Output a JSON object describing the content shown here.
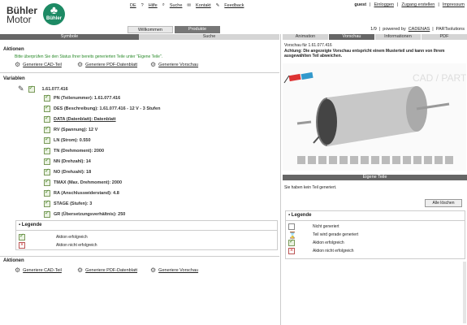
{
  "brand": {
    "name_line1": "Bühler",
    "name_line2": "Motor",
    "emblem_text": "Bühler"
  },
  "toplinks": {
    "lang": "DE",
    "help": "Hilfe",
    "search": "Suche",
    "contact": "Kontakt",
    "feedback": "Feedback"
  },
  "user": {
    "name": "guest",
    "login": "Einloggen",
    "request": "Zugang erstellen",
    "imprint": "Impressum"
  },
  "powered": {
    "page": "1/9",
    "text": "powered by",
    "cadenas": "CADENAS",
    "partsolutions": "PARTsolutions"
  },
  "main_tabs": [
    {
      "label": "Willkommen"
    },
    {
      "label": "Produkte"
    }
  ],
  "sub_tabs": {
    "symbols": "Symbole",
    "search": "Suche"
  },
  "right_tabs": [
    {
      "label": "Animation"
    },
    {
      "label": "Vorschau"
    },
    {
      "label": "Informationen"
    },
    {
      "label": "PDF"
    }
  ],
  "actions": {
    "title": "Aktionen",
    "note": "Bitte überprüfen Sie den Status Ihrer bereits generierten Teile unter \"Eigene Teile\".",
    "cad": "Generiere CAD-Teil",
    "pdf": "Generiere PDF-Datenblatt",
    "preview": "Generiere Vorschau"
  },
  "variables": {
    "title": "Variablen",
    "root": "1.61.077.416",
    "rows": [
      {
        "label": "PN (Teilenummer): 1.61.077.416"
      },
      {
        "label": "DES (Beschreibung): 1.61.077.416 - 12 V - 3 Stufen"
      },
      {
        "label": "DATA (Datenblatt): Datenblatt"
      },
      {
        "label": "RV (Spannung): 12 V"
      },
      {
        "label": "LN (Strom): 0.550"
      },
      {
        "label": "TN (Drehmoment): 2000"
      },
      {
        "label": "NN (Drehzahl): 14"
      },
      {
        "label": "NO (Drehzahl): 18"
      },
      {
        "label": "TMAX (Max. Drehmoment): 2000"
      },
      {
        "label": "RA (Anschlusswiderstand): 4.8"
      },
      {
        "label": "STAGE (Stufen): 3"
      },
      {
        "label": "GR (Übersetzungsverhältnis): 250"
      }
    ]
  },
  "legend_left": {
    "title": "Legende",
    "ok": "Aktion erfolgreich",
    "fail": "Aktion nicht erfolgreich"
  },
  "actions_bottom": {
    "title": "Aktionen",
    "cad": "Generiere CAD-Teil",
    "pdf": "Generiere PDF-Datenblatt",
    "preview": "Generiere Vorschau"
  },
  "preview": {
    "title": "Vorschau für 1.61.077.416",
    "warning": "Achtung: Die angezeigte Vorschau entspricht einem Musterteil und kann von Ihrem ausgewählten Teil abweichen.",
    "watermark": "CAD / PART"
  },
  "own_parts": {
    "header": "Eigene Teile",
    "text": "Sie haben kein Teil generiert.",
    "delete_all": "Alle löschen"
  },
  "legend_right": {
    "title": "Legende",
    "not_generated": "Nicht generiert",
    "generating": "Teil wird gerade generiert",
    "ok": "Aktion erfolgreich",
    "fail": "Aktion nicht erfolgreich"
  },
  "colors": {
    "green": "#1d8a64",
    "tab_dark": "#777777",
    "header_dark": "#666666"
  }
}
